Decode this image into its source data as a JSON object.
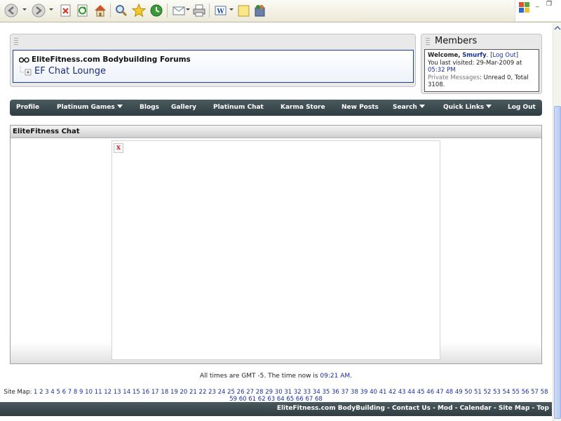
{
  "browser": {
    "toolbar_icons": [
      "back-icon",
      "forward-icon",
      "stop-icon",
      "refresh-icon",
      "home-icon",
      "search-icon",
      "favorites-icon",
      "history-icon",
      "mail-icon",
      "print-icon",
      "edit-icon",
      "discuss-icon",
      "messenger-icon"
    ],
    "window_controls": {
      "minimize": "_",
      "restore": "❐"
    }
  },
  "forum_header": {
    "forum_name": "EliteFitness.com Bodybuilding Forums",
    "current_page": "EF Chat Lounge"
  },
  "members": {
    "title": "Members",
    "welcome_label": "Welcome,",
    "username": "Smurfy",
    "logout_open": "[",
    "logout_label": "Log Out",
    "logout_close": "]",
    "last_visited_label": "You last visited: 29-Mar-2009 at",
    "last_visited_time": "05:32 PM",
    "pm_label": "Private Messages",
    "pm_text": ": Unread 0, Total 3108."
  },
  "navbar": {
    "items": [
      {
        "label": "Profile",
        "dropdown": false
      },
      {
        "label": "Platinum Games",
        "dropdown": true
      },
      {
        "label": "Blogs",
        "dropdown": false
      },
      {
        "label": "Gallery",
        "dropdown": false
      },
      {
        "label": "Platinum Chat",
        "dropdown": false
      },
      {
        "label": "Karma Store",
        "dropdown": false
      },
      {
        "label": "New Posts",
        "dropdown": false
      },
      {
        "label": "Search",
        "dropdown": true
      },
      {
        "label": "Quick Links",
        "dropdown": true
      },
      {
        "label": "Log Out",
        "dropdown": false
      }
    ]
  },
  "chat": {
    "title": "EliteFitness Chat",
    "broken_image_glyph": "x"
  },
  "footer": {
    "time_prefix": "All times are GMT -5. The time now is",
    "time_value": "09:21 AM",
    "time_suffix": ".",
    "sitemap_label": "Site Map:",
    "sitemap_pages": 68,
    "bottom_links": [
      "EliteFitness.com BodyBuilding",
      "Contact Us",
      "Mod",
      "Calendar",
      "Site Map",
      "Top"
    ],
    "bottom_separator": " - "
  },
  "colors": {
    "navbar_bg": "#3b4a4e",
    "link_blue": "#1a2d9c",
    "border_blue": "#1d3f8a"
  }
}
